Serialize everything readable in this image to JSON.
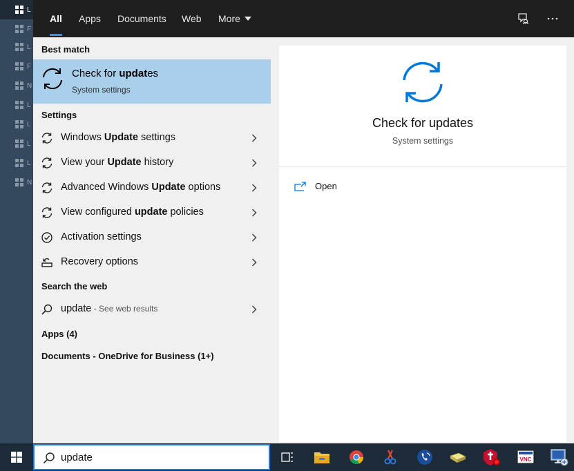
{
  "background_items": [
    "L",
    "F",
    "L",
    "F",
    "N",
    "L",
    "L",
    "L",
    "L",
    "N"
  ],
  "tabs": {
    "all": "All",
    "apps": "Apps",
    "documents": "Documents",
    "web": "Web",
    "more": "More"
  },
  "sections": {
    "best_match": "Best match",
    "settings": "Settings",
    "search_web": "Search the web",
    "apps": "Apps (4)",
    "documents": "Documents - OneDrive for Business (1+)"
  },
  "best_match": {
    "title_prefix": "Check for ",
    "title_bold": "updat",
    "title_suffix": "es",
    "subtitle": "System settings"
  },
  "settings_items": [
    {
      "pre": "Windows ",
      "bold": "Update",
      "post": " settings",
      "icon": "sync-icon"
    },
    {
      "pre": "View your ",
      "bold": "Update",
      "post": " history",
      "icon": "sync-icon"
    },
    {
      "pre": "Advanced Windows ",
      "bold": "Update",
      "post": " options",
      "icon": "sync-icon"
    },
    {
      "pre": "View configured ",
      "bold": "update",
      "post": " policies",
      "icon": "sync-icon"
    },
    {
      "pre": "Activation settings",
      "bold": "",
      "post": "",
      "icon": "check-circle-icon"
    },
    {
      "pre": "Recovery options",
      "bold": "",
      "post": "",
      "icon": "recovery-icon"
    }
  ],
  "web_result": {
    "query": "update",
    "suffix": " - See web results"
  },
  "preview": {
    "title": "Check for updates",
    "subtitle": "System settings",
    "open_label": "Open"
  },
  "search": {
    "value": "update"
  },
  "colors": {
    "accent": "#0078d7",
    "highlight": "#a9cfeb",
    "taskbar": "#1d2b39",
    "topbar": "#1f1f1f"
  }
}
